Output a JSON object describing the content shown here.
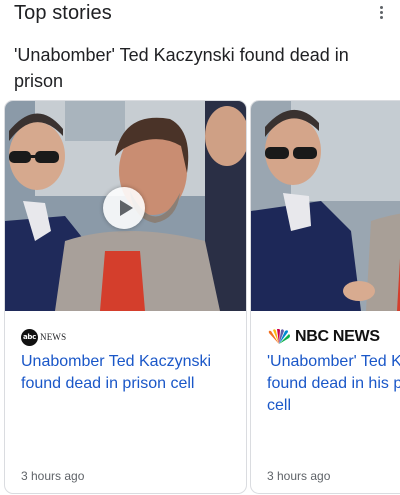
{
  "header": {
    "title": "Top stories",
    "more_icon": "more-vert-icon"
  },
  "headline": "'Unabomber' Ted Kaczynski found dead in prison",
  "cards": [
    {
      "publisher": "NEWS",
      "publisher_logo_text": "abc",
      "title": "Unabomber Ted Kaczynski found dead in prison cell",
      "time": "3 hours ago",
      "has_video": true,
      "play_icon": "play-icon"
    },
    {
      "publisher": "NBC NEWS",
      "publisher_logo_icon": "peacock-icon",
      "title": "'Unabomber' Ted K\nfound dead in his p\ncell",
      "time": "3 hours ago",
      "has_video": false
    }
  ],
  "colors": {
    "link": "#1a57c8",
    "text": "#202124",
    "muted": "#5f6368",
    "border": "#dadce0"
  }
}
